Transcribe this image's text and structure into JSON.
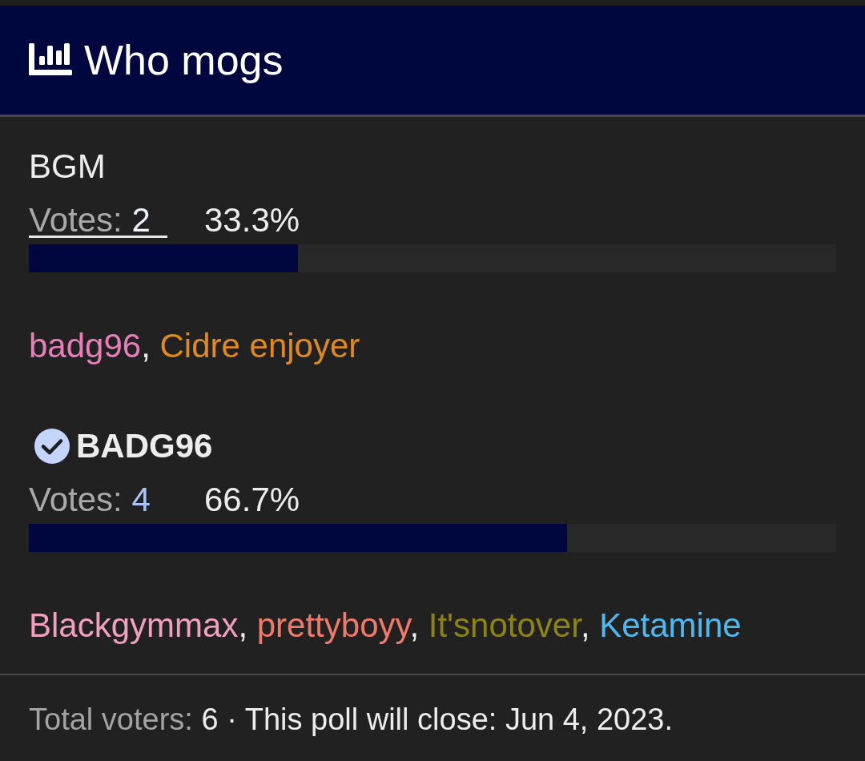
{
  "poll": {
    "title": "Who mogs"
  },
  "voter_separator": ",",
  "options": [
    {
      "label": "BGM",
      "selected": false,
      "votes_label": "Votes:",
      "votes": "2",
      "focused": true,
      "percent": "33.3%",
      "level": 0.333,
      "voters": [
        {
          "name": "badg96",
          "color": "#e87eb8"
        },
        {
          "name": "Cidre enjoyer",
          "color": "#e0891e"
        }
      ]
    },
    {
      "label": "BADG96",
      "selected": true,
      "votes_label": "Votes:",
      "votes": "4",
      "focused": false,
      "percent": "66.7%",
      "level": 0.667,
      "voters": [
        {
          "name": "Blackgymmax",
          "color": "#f2a0c0"
        },
        {
          "name": "prettyboyy",
          "color": "#f07a6a"
        },
        {
          "name": "It'snotover",
          "color": "#8c8412"
        },
        {
          "name": "Ketamine",
          "color": "#4fb8ef"
        }
      ]
    }
  ],
  "footer": {
    "total_label": "Total voters:",
    "total_value": "6",
    "separator": "·",
    "closing": "This poll will close: Jun 4, 2023."
  }
}
